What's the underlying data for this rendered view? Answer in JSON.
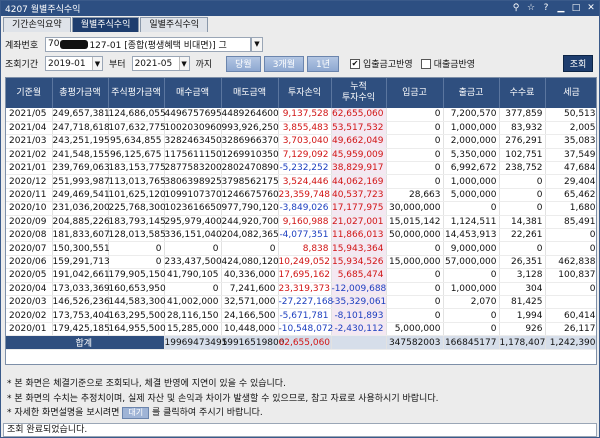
{
  "window": {
    "title": "4207 월별주식수익"
  },
  "tabs": [
    "기간손익요약",
    "월별주식수익",
    "일별주식수익"
  ],
  "account": {
    "label": "계좌번호",
    "prefix": "70",
    "value": "127-01 [종합(평생혜택 비대면)] 그"
  },
  "period": {
    "label": "조회기간",
    "from": "2019-01",
    "from_suffix": "부터",
    "to": "2021-05",
    "to_suffix": "까지"
  },
  "buttons": {
    "this_year": "당월",
    "three_months": "3개월",
    "one_year": "1년",
    "query": "조회",
    "help": "대기"
  },
  "options": {
    "deposit_label": "입출금고반영",
    "deposit_checked": true,
    "loan_label": "대출금반영",
    "loan_checked": false
  },
  "columns": [
    "기준월",
    "총평가금액",
    "주식평가금액",
    "매수금액",
    "매도금액",
    "투자손익",
    "누적\n투자수익",
    "입금고",
    "출금고",
    "수수료",
    "세금"
  ],
  "rows": [
    [
      "2021/05",
      "249,657,381",
      "124,686,055",
      "4496757695",
      "4489264600",
      "9,137,528",
      "62,655,060",
      "0",
      "7,200,570",
      "377,859",
      "50,513"
    ],
    [
      "2021/04",
      "247,718,618",
      "107,632,775",
      "1002030960",
      "993,926,250",
      "3,855,483",
      "53,517,532",
      "0",
      "1,000,000",
      "83,932",
      "2,005"
    ],
    [
      "2021/03",
      "243,251,195",
      "95,634,855",
      "3282463450",
      "3286966370",
      "3,703,040",
      "49,662,049",
      "0",
      "2,000,000",
      "276,291",
      "35,083"
    ],
    [
      "2021/02",
      "241,548,155",
      "96,125,675",
      "1175611150",
      "1269910350",
      "7,129,092",
      "45,959,009",
      "0",
      "5,350,000",
      "102,751",
      "37,549"
    ],
    [
      "2021/01",
      "239,769,063",
      "183,153,775",
      "2877583200",
      "2802470890",
      "-5,232,252",
      "38,829,917",
      "0",
      "6,992,672",
      "238,752",
      "47,684"
    ],
    [
      "2020/12",
      "251,993,987",
      "113,013,765",
      "3806398925",
      "3798562175",
      "3,524,446",
      "44,062,169",
      "0",
      "1,000,000",
      "0",
      "29,404"
    ],
    [
      "2020/11",
      "249,469,541",
      "101,625,120",
      "1099107370",
      "1246675760",
      "23,359,748",
      "40,537,723",
      "28,663",
      "5,000,000",
      "0",
      "65,462"
    ],
    [
      "2020/10",
      "231,036,200",
      "225,768,300",
      "1023616650",
      "977,790,120",
      "-3,849,026",
      "17,177,975",
      "30,000,000",
      "0",
      "0",
      "1,680"
    ],
    [
      "2020/09",
      "204,885,226",
      "183,793,145",
      "295,979,400",
      "244,920,700",
      "9,160,988",
      "21,027,001",
      "15,015,142",
      "1,124,511",
      "14,381",
      "85,491"
    ],
    [
      "2020/08",
      "181,833,607",
      "128,013,585",
      "336,151,040",
      "204,082,365",
      "-4,077,351",
      "11,866,013",
      "50,000,000",
      "14,453,913",
      "22,261",
      "0"
    ],
    [
      "2020/07",
      "150,300,551",
      "0",
      "0",
      "0",
      "8,838",
      "15,943,364",
      "0",
      "9,000,000",
      "0",
      "0"
    ],
    [
      "2020/06",
      "159,291,713",
      "0",
      "233,437,500",
      "424,080,120",
      "10,249,052",
      "15,934,526",
      "15,000,000",
      "57,000,000",
      "26,351",
      "462,838"
    ],
    [
      "2020/05",
      "191,042,661",
      "179,905,150",
      "41,790,105",
      "40,336,000",
      "17,695,162",
      "5,685,474",
      "0",
      "0",
      "3,128",
      "100,837"
    ],
    [
      "2020/04",
      "173,033,369",
      "160,653,950",
      "0",
      "7,241,600",
      "23,319,373",
      "-12,009,688",
      "0",
      "1,000,000",
      "304",
      "0"
    ],
    [
      "2020/03",
      "146,526,236",
      "144,583,300",
      "41,002,000",
      "32,571,000",
      "-27,227,168",
      "-35,329,061",
      "0",
      "2,070",
      "81,425",
      ""
    ],
    [
      "2020/02",
      "173,753,404",
      "163,295,500",
      "28,116,150",
      "24,166,500",
      "-5,671,781",
      "-8,101,893",
      "0",
      "0",
      "1,994",
      "60,414"
    ],
    [
      "2020/01",
      "179,425,185",
      "164,955,500",
      "15,285,000",
      "10,448,000",
      "-10,548,072",
      "-2,430,112",
      "5,000,000",
      "0",
      "926",
      "26,117"
    ]
  ],
  "total": {
    "label": "합계",
    "buy": "19969473495",
    "sell": "19916519800",
    "profit": "62,655,060",
    "deposit": "347582003",
    "withdraw": "166845177",
    "fee": "1,178,407",
    "tax": "1,242,390"
  },
  "notes": [
    "* 본 화면은 체결기준으로 조회되나, 체결 반영에 지연이 있을 수 있습니다.",
    "* 본 화면의 수치는 추정치이며, 실제 자산 및 손익과 차이가 발생할 수 있으므로, 참고 자료로 사용하시기 바랍니다.",
    "* 자세한 화면설명을 보시려면",
    "를 클릭하여 주시기 바랍니다."
  ],
  "status": "조회 완료되었습니다."
}
